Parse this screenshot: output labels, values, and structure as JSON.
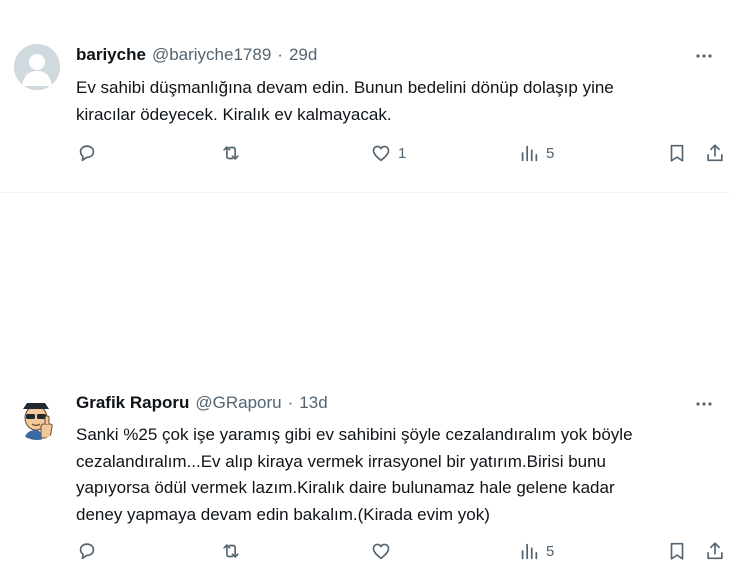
{
  "tweets": [
    {
      "display_name": "bariyche",
      "handle": "@bariyche1789",
      "separator": "·",
      "time": "29d",
      "avatar": "default-person-avatar",
      "text_lines": [
        "Ev sahibi düşmanlığına devam edin. Bunun bedelini dönüp dolaşıp yine",
        "kiracılar ödeyecek. Kiralık ev kalmayacak."
      ],
      "likes": "1",
      "views": "5",
      "icons": [
        "reply-icon",
        "retweet-icon",
        "like-icon",
        "views-icon",
        "bookmark-icon",
        "share-icon",
        "more-icon"
      ]
    },
    {
      "display_name": "Grafik Raporu",
      "handle": "@GRaporu",
      "separator": "·",
      "time": "13d",
      "avatar": "cartoon-thumbs-up-avatar",
      "text_lines": [
        "Sanki %25 çok işe yaramış gibi ev sahibini şöyle cezalandıralım yok böyle",
        "cezalandıralım...Ev alıp kiraya vermek irrasyonel bir yatırım.Birisi bunu",
        "yapıyorsa ödül vermek lazım.Kiralık daire bulunamaz hale gelene kadar",
        "deney yapmaya devam edin bakalım.(Kirada evim yok)"
      ],
      "likes": "",
      "views": "5",
      "icons": [
        "reply-icon",
        "retweet-icon",
        "like-icon",
        "views-icon",
        "bookmark-icon",
        "share-icon",
        "more-icon"
      ]
    }
  ],
  "colors": {
    "text": "#0f1419",
    "secondary": "#536471",
    "divider": "#eff3f4",
    "avatar_default_bg": "#cfd9de"
  }
}
